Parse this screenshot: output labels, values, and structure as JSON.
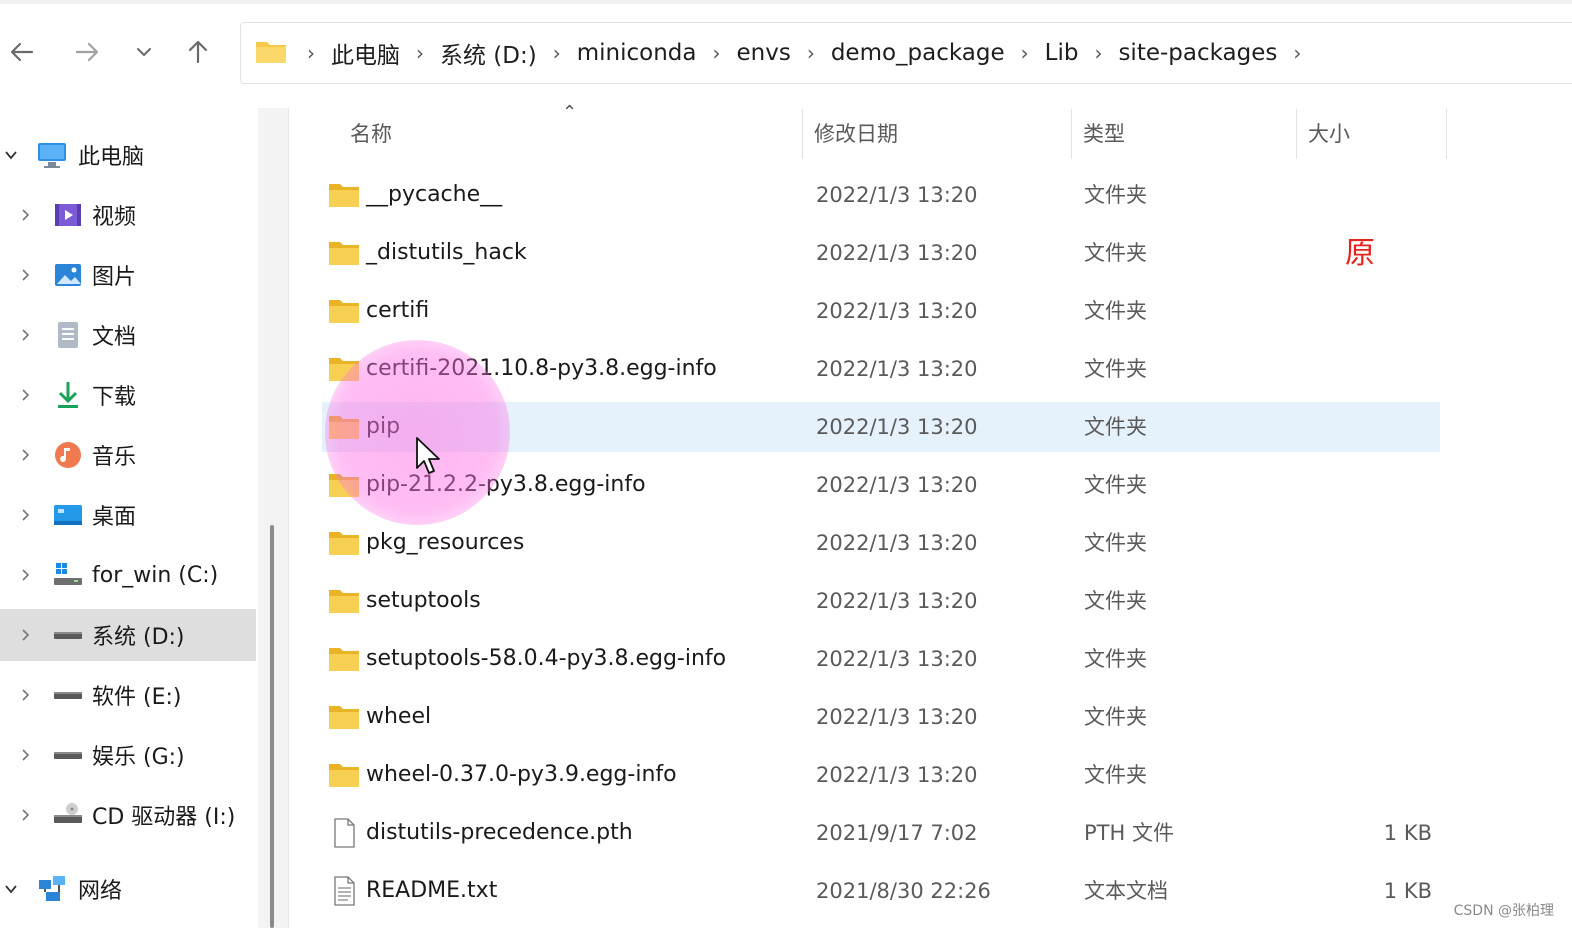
{
  "nav": {
    "back": "back-arrow",
    "forward": "forward-arrow",
    "recent": "chevron-down",
    "up": "up-arrow"
  },
  "breadcrumb": [
    "此电脑",
    "系统 (D:)",
    "miniconda",
    "envs",
    "demo_package",
    "Lib",
    "site-packages"
  ],
  "sidebar": {
    "items": [
      {
        "label": "此电脑",
        "icon": "pc-icon",
        "expanded": true
      },
      {
        "label": "视频",
        "icon": "video-icon"
      },
      {
        "label": "图片",
        "icon": "picture-icon"
      },
      {
        "label": "文档",
        "icon": "document-icon"
      },
      {
        "label": "下载",
        "icon": "download-icon"
      },
      {
        "label": "音乐",
        "icon": "music-icon"
      },
      {
        "label": "桌面",
        "icon": "desktop-icon"
      },
      {
        "label": "for_win (C:)",
        "icon": "windows-drive-icon"
      },
      {
        "label": "系统 (D:)",
        "icon": "drive-icon",
        "selected": true
      },
      {
        "label": "软件 (E:)",
        "icon": "drive-icon"
      },
      {
        "label": "娱乐 (G:)",
        "icon": "drive-icon"
      },
      {
        "label": "CD 驱动器 (I:)",
        "icon": "cd-drive-icon"
      },
      {
        "label": "网络",
        "icon": "network-icon",
        "expanded": true
      }
    ]
  },
  "columns": {
    "name": "名称",
    "date": "修改日期",
    "type": "类型",
    "size": "大小"
  },
  "files": [
    {
      "name": "__pycache__",
      "date": "2022/1/3 13:20",
      "type": "文件夹",
      "size": "",
      "icon": "folder"
    },
    {
      "name": "_distutils_hack",
      "date": "2022/1/3 13:20",
      "type": "文件夹",
      "size": "",
      "icon": "folder"
    },
    {
      "name": "certifi",
      "date": "2022/1/3 13:20",
      "type": "文件夹",
      "size": "",
      "icon": "folder"
    },
    {
      "name": "certifi-2021.10.8-py3.8.egg-info",
      "date": "2022/1/3 13:20",
      "type": "文件夹",
      "size": "",
      "icon": "folder"
    },
    {
      "name": "pip",
      "date": "2022/1/3 13:20",
      "type": "文件夹",
      "size": "",
      "icon": "folder",
      "selected": true
    },
    {
      "name": "pip-21.2.2-py3.8.egg-info",
      "date": "2022/1/3 13:20",
      "type": "文件夹",
      "size": "",
      "icon": "folder"
    },
    {
      "name": "pkg_resources",
      "date": "2022/1/3 13:20",
      "type": "文件夹",
      "size": "",
      "icon": "folder"
    },
    {
      "name": "setuptools",
      "date": "2022/1/3 13:20",
      "type": "文件夹",
      "size": "",
      "icon": "folder"
    },
    {
      "name": "setuptools-58.0.4-py3.8.egg-info",
      "date": "2022/1/3 13:20",
      "type": "文件夹",
      "size": "",
      "icon": "folder"
    },
    {
      "name": "wheel",
      "date": "2022/1/3 13:20",
      "type": "文件夹",
      "size": "",
      "icon": "folder"
    },
    {
      "name": "wheel-0.37.0-py3.9.egg-info",
      "date": "2022/1/3 13:20",
      "type": "文件夹",
      "size": "",
      "icon": "folder"
    },
    {
      "name": "distutils-precedence.pth",
      "date": "2021/9/17 7:02",
      "type": "PTH 文件",
      "size": "1 KB",
      "icon": "file"
    },
    {
      "name": "README.txt",
      "date": "2021/8/30 22:26",
      "type": "文本文档",
      "size": "1 KB",
      "icon": "text-file"
    }
  ],
  "annotation": "原",
  "watermark": "CSDN @张柏理",
  "colors": {
    "selection": "#e5f1fb",
    "folder": "#f7c948",
    "annotation": "#e8231e",
    "halo": "#ff7ae6"
  }
}
